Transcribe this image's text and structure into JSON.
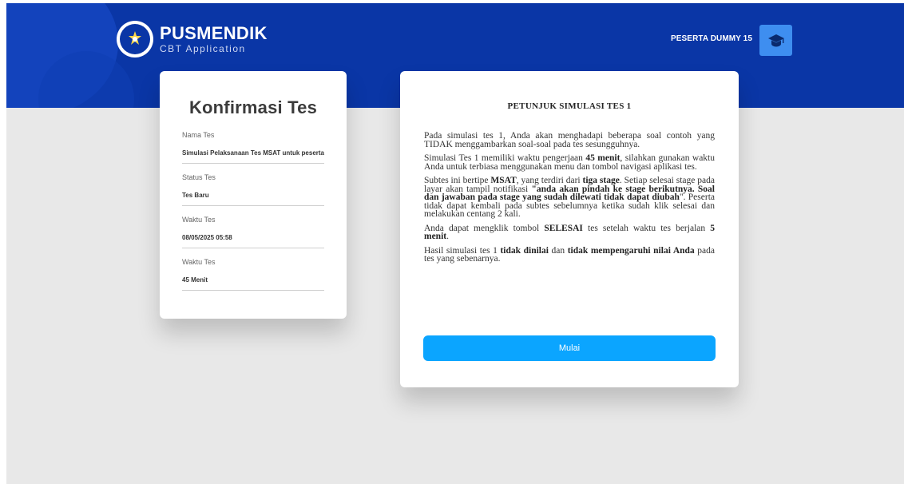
{
  "header": {
    "brand_name": "PUSMENDIK",
    "brand_sub": "CBT Application",
    "user_name": "PESERTA DUMMY 15",
    "logo_icon": "tut-wuri-handayani-logo",
    "avatar_icon": "graduation-cap-icon",
    "band_color": "#0a36a6",
    "avatar_color": "#3e8ef0"
  },
  "confirm": {
    "title": "Konfirmasi Tes",
    "fields": [
      {
        "label": "Nama Tes",
        "value": "Simulasi Pelaksanaan Tes MSAT untuk peserta"
      },
      {
        "label": "Status Tes",
        "value": "Tes Baru"
      },
      {
        "label": "Waktu Tes",
        "value": "08/05/2025 05:58"
      },
      {
        "label": "Waktu Tes",
        "value": "45 Menit"
      }
    ]
  },
  "info": {
    "title": "PETUNJUK SIMULASI TES 1",
    "p1": "Pada simulasi tes 1, Anda akan menghadapi beberapa soal contoh yang TIDAK menggambarkan soal-soal pada tes sesungguhnya.",
    "p2_a": "Simulasi Tes 1 memiliki waktu pengerjaan ",
    "p2_b": "45 menit",
    "p2_c": ", silahkan gunakan waktu Anda untuk terbiasa menggunakan menu dan tombol navigasi aplikasi tes.",
    "p3_a": "Subtes ini bertipe ",
    "p3_b": "MSAT",
    "p3_c": ", yang terdiri dari ",
    "p3_d": "tiga stage",
    "p3_e": ". Setiap selesai stage pada layar akan tampil notifikasi ",
    "p3_f": "\"anda akan pindah ke stage berikutnya. Soal dan jawaban pada stage yang sudah dilewati tidak dapat diubah",
    "p3_g": "\".  Peserta tidak dapat kembali pada subtes sebelumnya ketika sudah klik selesai dan melakukan centang 2 kali.",
    "p4_a": "Anda dapat mengklik tombol ",
    "p4_b": "SELESAI",
    "p4_c": " tes setelah waktu tes berjalan ",
    "p4_d": "5 menit",
    "p4_e": ".",
    "p5_a": "Hasil simulasi tes 1 ",
    "p5_b": "tidak dinilai",
    "p5_c": " dan ",
    "p5_d": "tidak mempengaruhi nilai Anda",
    "p5_e": " pada tes yang sebenarnya.",
    "button_label": "Mulai",
    "button_color": "#0ba5ff"
  }
}
